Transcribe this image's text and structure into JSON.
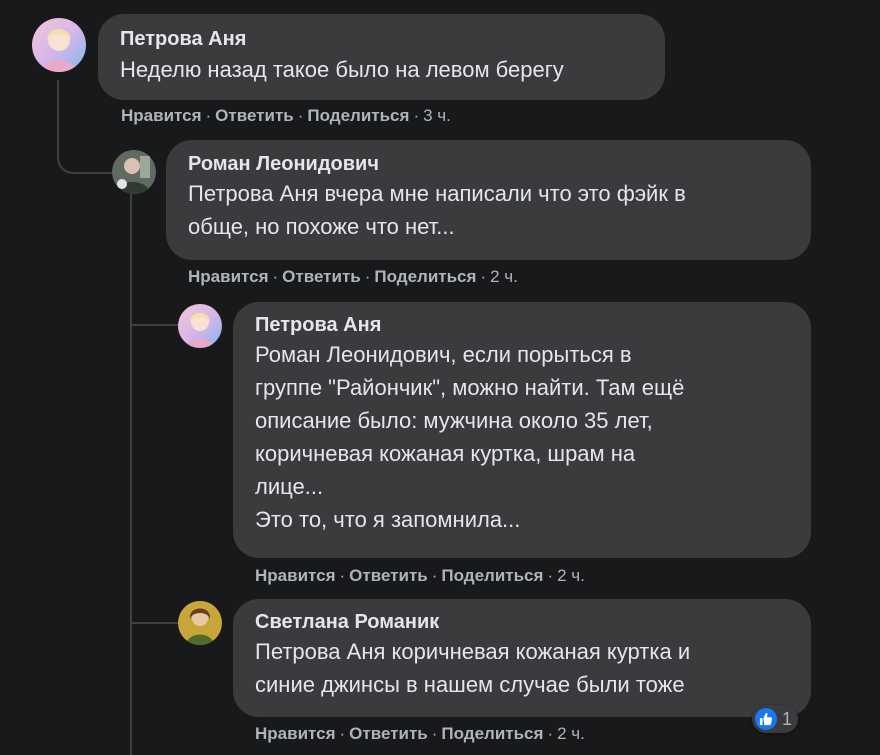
{
  "comments": [
    {
      "author": "Петрова Аня",
      "lines": [
        "Неделю назад такое было на левом берегу"
      ],
      "time": "3 ч."
    },
    {
      "author": "Роман Леонидович",
      "lines": [
        "Петрова Аня вчера мне написали что это фэйк в",
        "обще, но похоже что нет..."
      ],
      "time": "2 ч."
    },
    {
      "author": "Петрова Аня",
      "lines": [
        "Роман Леонидович, если порыться в",
        "группе \"Райончик\", можно найти. Там ещё",
        "описание было: мужчина около 35 лет,",
        "коричневая кожаная куртка, шрам на",
        "лице...",
        "Это то, что я запомнила..."
      ],
      "time": "2 ч."
    },
    {
      "author": "Светлана Романик",
      "lines": [
        "Петрова Аня коричневая кожаная куртка и",
        "синие джинсы в нашем случае были тоже"
      ],
      "time": "2 ч.",
      "reaction_count": "1",
      "reaction_icon": "thumbs-up-icon"
    }
  ],
  "actions": {
    "like": "Нравится",
    "reply": "Ответить",
    "share": "Поделиться",
    "separator": "·"
  },
  "colors": {
    "background": "#18191a",
    "bubble": "#3a3b3c",
    "text": "#e4e6eb",
    "secondary_text": "#b0b3b8",
    "like_blue": "#1877f2"
  }
}
